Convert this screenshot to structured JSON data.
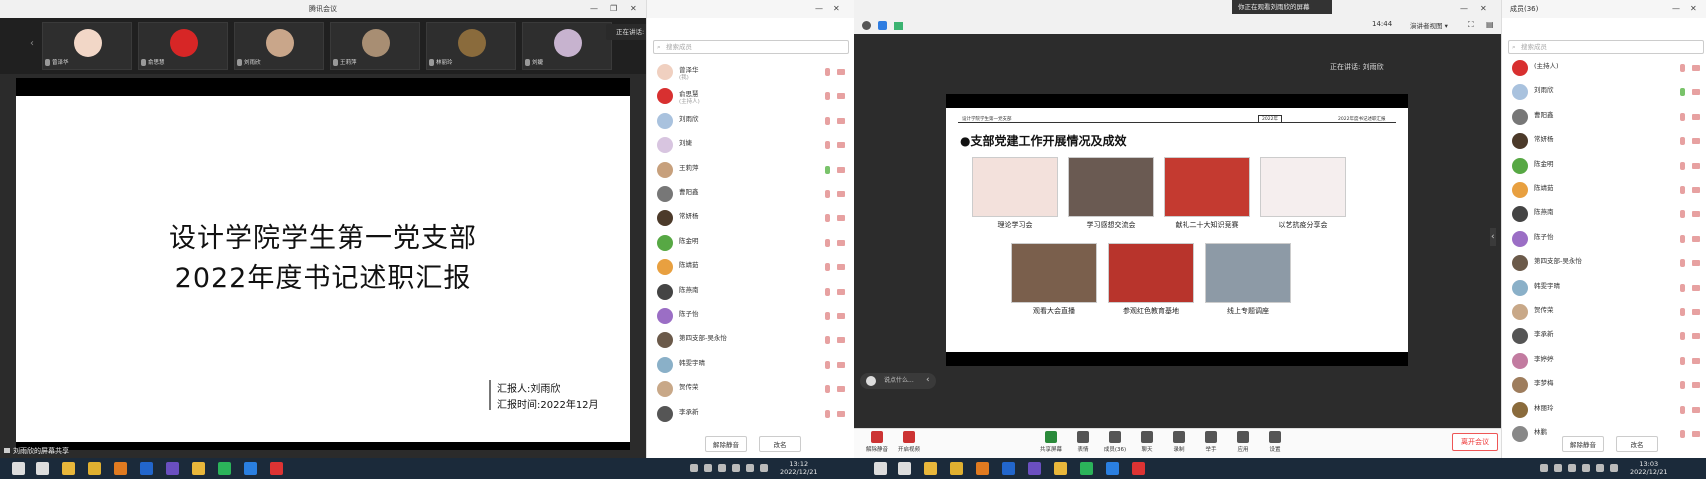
{
  "left_window": {
    "title": "腾讯会议",
    "participants": [
      {
        "name": "曾泽华",
        "color": "#f2d7c7"
      },
      {
        "name": "俞思慧",
        "color": "#d72626"
      },
      {
        "name": "刘雨欣",
        "color": "#c9a68a"
      },
      {
        "name": "王莉萍",
        "color": "#a88e73"
      },
      {
        "name": "林丽玲",
        "color": "#8a6b3c"
      },
      {
        "name": "刘婕",
        "color": "#c7b3cf"
      }
    ],
    "speaking_tip": "正在讲话: 王莉萍",
    "slide": {
      "title_line1": "设计学院学生第一党支部",
      "title_line2": "2022年度书记述职汇报",
      "reporter": "汇报人:刘雨欣",
      "report_time": "汇报时间:2022年12月"
    },
    "share_status": "刘雨欣的屏幕共享"
  },
  "left_panel": {
    "search_placeholder": "搜索成员",
    "members": [
      {
        "name": "曾泽华",
        "sub": "(我)",
        "color": "#f0d0c0",
        "mic_on": false
      },
      {
        "name": "俞思慧",
        "sub": "(主持人)",
        "color": "#d83030",
        "mic_on": false
      },
      {
        "name": "刘雨欣",
        "sub": "",
        "color": "#a9c2de",
        "mic_on": false
      },
      {
        "name": "刘婕",
        "sub": "",
        "color": "#d8c5e0",
        "mic_on": false
      },
      {
        "name": "王莉萍",
        "sub": "",
        "color": "#c7a07c",
        "mic_on": true
      },
      {
        "name": "曹阳鑫",
        "sub": "",
        "color": "#777777",
        "mic_on": false
      },
      {
        "name": "常妍杨",
        "sub": "",
        "color": "#4c3a2a",
        "mic_on": false
      },
      {
        "name": "陈金明",
        "sub": "",
        "color": "#57a844",
        "mic_on": false
      },
      {
        "name": "陈靖茹",
        "sub": "",
        "color": "#e8a040",
        "mic_on": false
      },
      {
        "name": "陈燕南",
        "sub": "",
        "color": "#444444",
        "mic_on": false
      },
      {
        "name": "陈子怡",
        "sub": "",
        "color": "#9b6ec5",
        "mic_on": false
      },
      {
        "name": "第四支部-吴永怡",
        "sub": "",
        "color": "#6b5a4a",
        "mic_on": false
      },
      {
        "name": "韩雯宇晴",
        "sub": "",
        "color": "#8ab0c8",
        "mic_on": false
      },
      {
        "name": "贺传荣",
        "sub": "",
        "color": "#c8a888",
        "mic_on": false
      },
      {
        "name": "李承新",
        "sub": "",
        "color": "#555555",
        "mic_on": false
      }
    ],
    "btn_unmute": "解除静音",
    "btn_rename": "改名"
  },
  "right_window": {
    "banner": "你正在观看刘雨欣的屏幕",
    "time": "14:44",
    "view_mode": "演讲者视图",
    "speaking": "正在讲话: 刘雨欣",
    "slide": {
      "header_left": "设计学院学生第一党支部",
      "header_mid": "2022年",
      "header_right": "2022年度书记述职汇报",
      "heading": "●支部党建工作开展情况及成效",
      "items_row1": [
        "理论学习会",
        "学习感想交流会",
        "献礼二十大知识竞赛",
        "以艺抗疫分享会"
      ],
      "items_row2": [
        "观看大会直播",
        "参观红色教育基地",
        "线上专题调座"
      ]
    },
    "chat_placeholder": "说点什么...",
    "toolbar": [
      "解除静音",
      "开启视频",
      "共享屏幕",
      "表情",
      "成员(36)",
      "聊天",
      "录制",
      "举手",
      "应用",
      "设置"
    ],
    "leave": "离开会议"
  },
  "right_panel": {
    "title": "成员(36)",
    "search_placeholder": "搜索成员",
    "members": [
      {
        "name": "(主持人)",
        "color": "#d83030",
        "mic_on": false
      },
      {
        "name": "刘雨欣",
        "color": "#a9c2de",
        "mic_on": true
      },
      {
        "name": "曹阳鑫",
        "color": "#777777",
        "mic_on": false
      },
      {
        "name": "常妍杨",
        "color": "#4c3a2a",
        "mic_on": false
      },
      {
        "name": "陈金明",
        "color": "#57a844",
        "mic_on": false
      },
      {
        "name": "陈靖茹",
        "color": "#e8a040",
        "mic_on": false
      },
      {
        "name": "陈燕南",
        "color": "#444444",
        "mic_on": false
      },
      {
        "name": "陈子怡",
        "color": "#9b6ec5",
        "mic_on": false
      },
      {
        "name": "第四支部-吴永怡",
        "color": "#6b5a4a",
        "mic_on": false
      },
      {
        "name": "韩雯宇晴",
        "color": "#8ab0c8",
        "mic_on": false
      },
      {
        "name": "贺传荣",
        "color": "#c8a888",
        "mic_on": false
      },
      {
        "name": "李承新",
        "color": "#555555",
        "mic_on": false
      },
      {
        "name": "李婷婷",
        "color": "#c27ba0",
        "mic_on": false
      },
      {
        "name": "李梦梅",
        "color": "#9e7d5d",
        "mic_on": false
      },
      {
        "name": "林丽玲",
        "color": "#8a6b3c",
        "mic_on": false
      },
      {
        "name": "林鹏",
        "color": "#888888",
        "mic_on": false
      }
    ],
    "btn_unmute": "解除静音",
    "btn_rename": "改名"
  },
  "taskbar": {
    "time_left": "13:12",
    "date_left": "2022/12/21",
    "time_right": "13:03",
    "date_right": "2022/12/21"
  }
}
